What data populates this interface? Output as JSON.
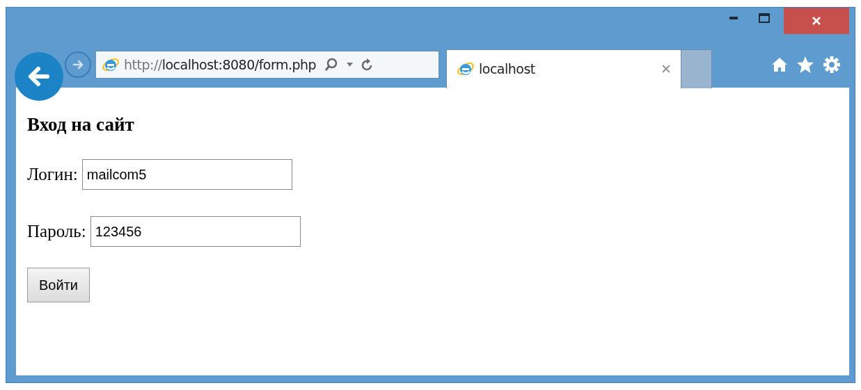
{
  "address_bar": {
    "scheme": "http://",
    "rest": "localhost:8080/form.php"
  },
  "tabs": [
    {
      "label": "localhost",
      "selected": true
    }
  ],
  "page": {
    "heading": "Вход на сайт",
    "fields": [
      {
        "label": "Логин:",
        "value": "mailcom5"
      },
      {
        "label": "Пароль:",
        "value": "123456"
      }
    ],
    "submit": "Войти"
  }
}
